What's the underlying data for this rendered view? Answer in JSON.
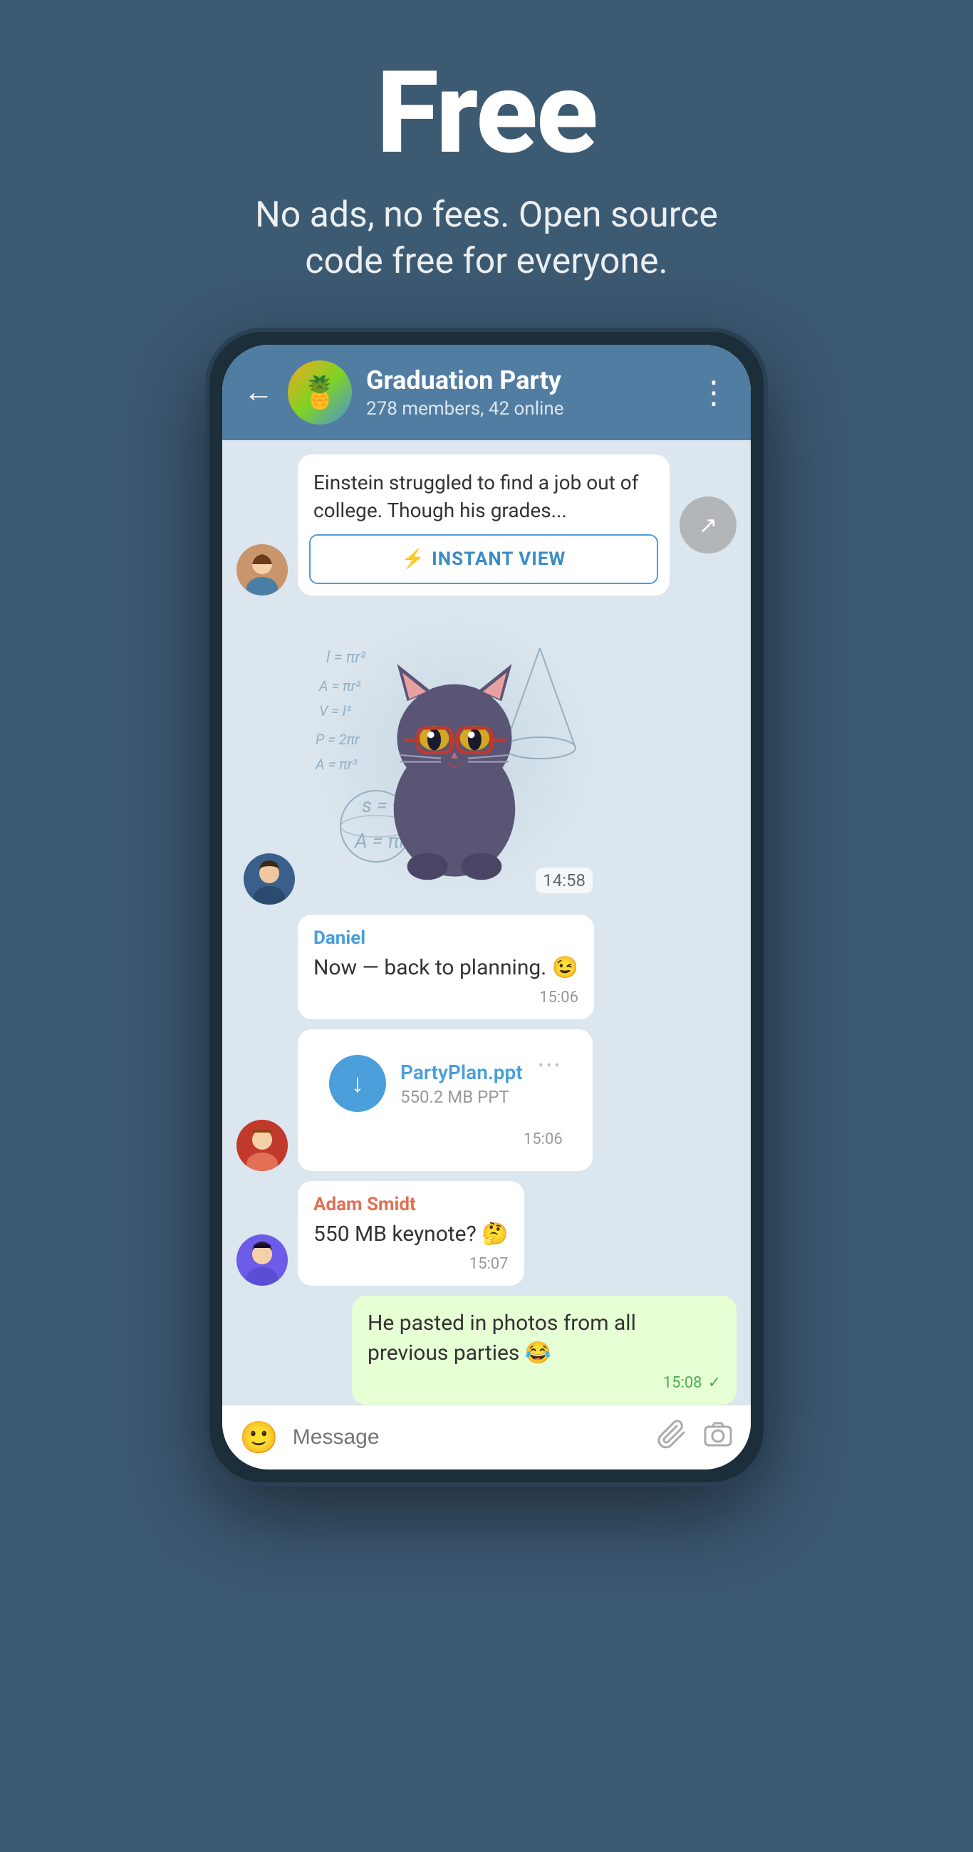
{
  "hero": {
    "title": "Free",
    "subtitle": "No ads, no fees. Open source\ncode free for everyone."
  },
  "chat": {
    "group_name": "Graduation Party",
    "group_members": "278 members, 42 online",
    "back_label": "←",
    "more_label": "⋮"
  },
  "messages": [
    {
      "id": "link_preview",
      "type": "link",
      "preview_text": "Einstein struggled to find a job out of college. Though his grades...",
      "instant_view_label": "INSTANT VIEW"
    },
    {
      "id": "sticker",
      "type": "sticker",
      "time": "14:58"
    },
    {
      "id": "msg_daniel",
      "type": "received",
      "sender": "Daniel",
      "text": "Now — back to planning. 😉",
      "time": "15:06"
    },
    {
      "id": "msg_file",
      "type": "file",
      "filename": "PartyPlan.ppt",
      "filesize": "550.2 MB PPT",
      "time": "15:06"
    },
    {
      "id": "msg_adam",
      "type": "received",
      "sender": "Adam Smidt",
      "sender_color": "orange",
      "text": "550 MB keynote? 🤔",
      "time": "15:07"
    },
    {
      "id": "msg_outgoing",
      "type": "outgoing",
      "text": "He pasted in photos from all previous parties 😂",
      "time": "15:08",
      "check": "✓"
    }
  ],
  "input_bar": {
    "placeholder": "Message",
    "emoji_icon": "🙂",
    "attach_icon": "📎",
    "camera_icon": "📷"
  }
}
